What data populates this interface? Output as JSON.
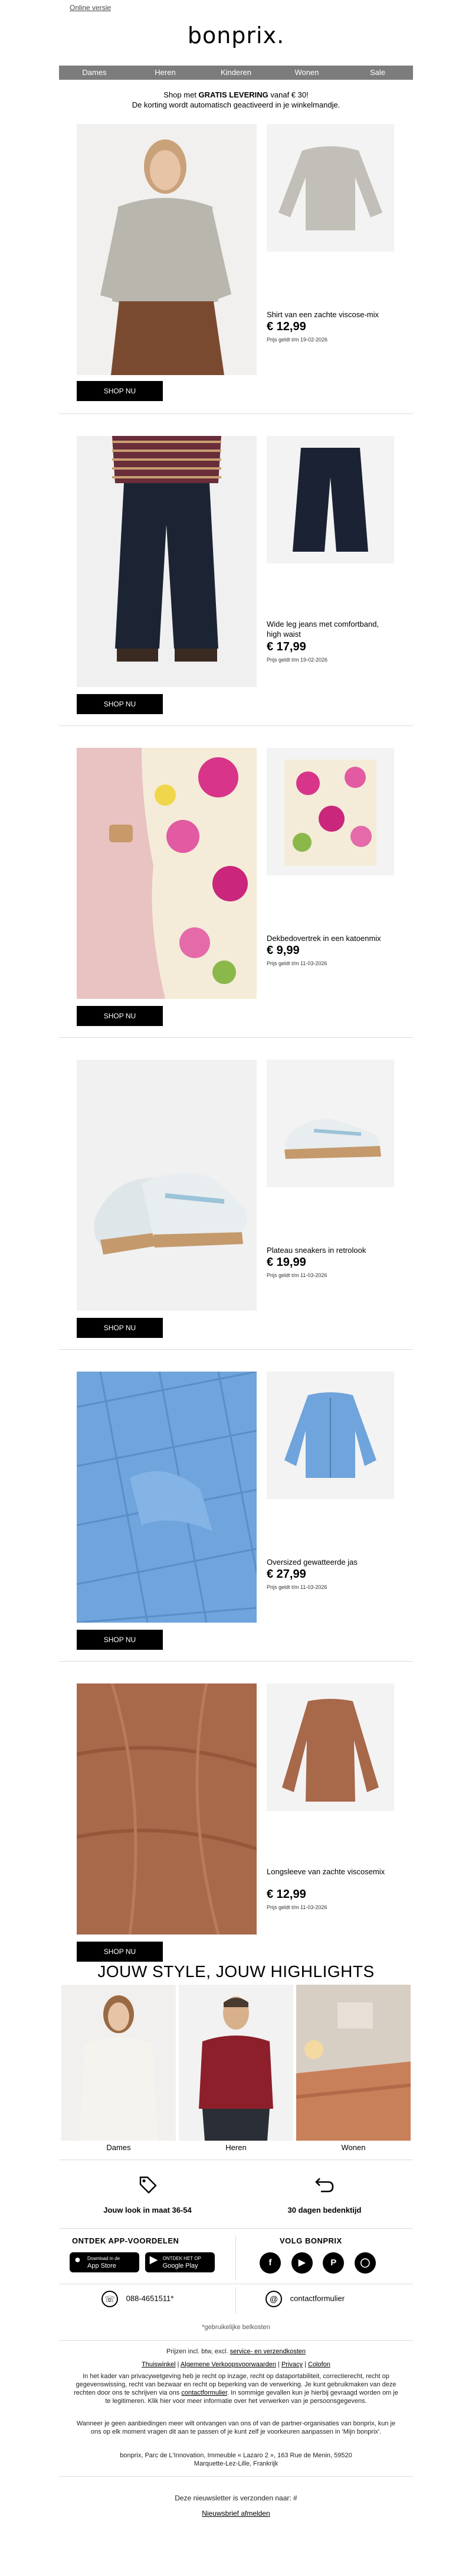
{
  "header": {
    "online_link": "Online versie",
    "logo": "bonprix."
  },
  "nav": [
    "Dames",
    "Heren",
    "Kinderen",
    "Wonen",
    "Sale"
  ],
  "promo": {
    "line1_prefix": "Shop met ",
    "line1_bold": "GRATIS LEVERING",
    "line1_suffix": " vanaf € 30!",
    "line2": "De korting wordt automatisch geactiveerd in je winkelmandje."
  },
  "products": [
    {
      "name": "Shirt van een zachte viscose-mix",
      "price": "€ 12,99",
      "note": "Prijs geldt t/m 19-02-2026",
      "button": "SHOP NU"
    },
    {
      "name": "Wide leg jeans met comfortband, high waist",
      "price": "€ 17,99",
      "note": "Prijs geldt t/m 19-02-2026",
      "button": "SHOP NU"
    },
    {
      "name": "Dekbedovertrek in een katoenmix",
      "price": "€ 9,99",
      "note": "Prijs geldt t/m 11-03-2026",
      "button": "SHOP NU"
    },
    {
      "name": "Plateau sneakers in retrolook",
      "price": "€ 19,99",
      "note": "Prijs geldt t/m 11-03-2026",
      "button": "SHOP NU"
    },
    {
      "name": "Oversized gewatteerde jas",
      "price": "€ 27,99",
      "note": "Prijs geldt t/m 11-03-2026",
      "button": "SHOP NU"
    },
    {
      "name": "Longsleeve van zachte viscosemix",
      "price": "€ 12,99",
      "note": "Prijs geldt t/m 11-03-2026",
      "button": "SHOP NU"
    }
  ],
  "highlights": {
    "title": "JOUW STYLE, JOUW HIGHLIGHTS",
    "items": [
      "Dames",
      "Heren",
      "Wonen"
    ]
  },
  "benefits": [
    {
      "icon": "tag-icon",
      "text": "Jouw look in maat 36-54"
    },
    {
      "icon": "return-icon",
      "text": "30 dagen bedenktijd"
    }
  ],
  "apps": {
    "title": "ONTDEK APP-VOORDELEN",
    "appstore_small": "Download in de",
    "appstore": "App Store",
    "googleplay_small": "ONTDEK HET OP",
    "googleplay": "Google Play"
  },
  "social": {
    "title": "VOLG BONPRIX",
    "icons": [
      "facebook-icon",
      "youtube-icon",
      "pinterest-icon",
      "instagram-icon"
    ]
  },
  "contact": {
    "phone": "088-4651511*",
    "form": "contactformulier",
    "note": "*gebruikelijke belkosten"
  },
  "footer": {
    "prices_prefix": "Prijzen incl. btw, excl. ",
    "prices_link": "service- en verzendkosten",
    "links": [
      "Thuiswinkel",
      "Algemene Verkoopsvoorwaarden",
      "Privacy",
      "Colofon"
    ],
    "privacy_text_1": "In het kader van privacywetgeving heb je recht op inzage, recht op dataportabiliteit, correctierecht, recht op gegevenswissing, recht van bezwaar en recht op beperking van de verwerking. Je kunt gebruikmaken van deze rechten door ons te schrijven via ons ",
    "privacy_link": "contactformulier",
    "privacy_text_2": ". In sommige gevallen kun je hierbij gevraagd worden om je te legitimeren. Klik hier voor meer informatie over het verwerken van je persoonsgegevens.",
    "partners": "Wanneer je geen aanbiedingen meer wilt ontvangen van ons of van de partner-organisaties van bonprix, kun je ons op elk moment vragen dit aan te passen of je kunt zelf je voorkeuren aanpassen in 'Mijn bonprix'.",
    "address_1": "bonprix, Parc de L'Innovation, Immeuble « Lazaro 2 », 163 Rue de Menin, 59520",
    "address_2": "Marquette-Lez-Lille, Frankrijk",
    "sent_to": "Deze nieuwsletter is verzonden naar: #",
    "unsubscribe": "Nieuwsbrief afmelden"
  },
  "colors": {
    "nav_bg": "#7c7c7c",
    "button_bg": "#000000",
    "photo_bg": "#eeeeee"
  }
}
